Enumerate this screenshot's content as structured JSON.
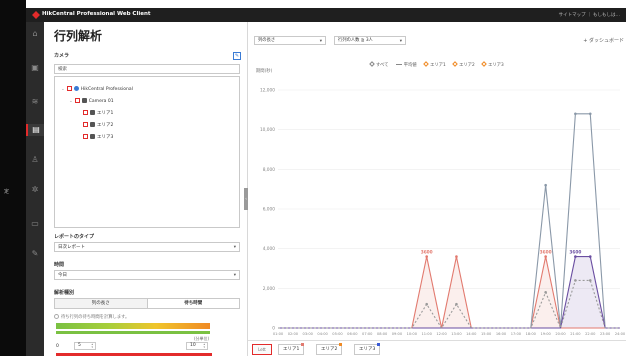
{
  "outer_label": "定",
  "app": {
    "title": "HikCentral Professional Web Client",
    "top_links": "サイトマップ ｜ もしもしは…"
  },
  "rail_icons": [
    {
      "name": "home-icon",
      "glyph": "⌂"
    },
    {
      "name": "image-icon",
      "glyph": "▣"
    },
    {
      "name": "map-icon",
      "glyph": "≋"
    },
    {
      "name": "report-icon",
      "glyph": "▤",
      "active": true
    },
    {
      "name": "people-icon",
      "glyph": "♙"
    },
    {
      "name": "settings-icon",
      "glyph": "✲"
    },
    {
      "name": "layers-icon",
      "glyph": "▭"
    },
    {
      "name": "pen-icon",
      "glyph": "✎"
    }
  ],
  "sidebar": {
    "title": "行列解析",
    "camera_label": "カメラ",
    "search_placeholder": "検索",
    "tree": [
      {
        "label": "HikCentral Professional",
        "icon": "site-icon"
      },
      {
        "label": "Camera 01",
        "icon": "camera-icon"
      },
      {
        "label": "エリア1",
        "icon": "area-icon"
      },
      {
        "label": "エリア2",
        "icon": "area-icon"
      },
      {
        "label": "エリア3",
        "icon": "area-icon"
      }
    ],
    "report_type_label": "レポートのタイプ",
    "report_type_value": "日次レポート",
    "time_label": "時間",
    "time_value": "今日",
    "analysis_label": "解析種別",
    "tab_queue_length": "列の長さ",
    "tab_wait_time": "待ち時間",
    "hint": "待ち行列の待ち時間を計算します。",
    "unit": "(分単位)",
    "range_min": "0",
    "range_max_input": "10",
    "low_input": "5"
  },
  "main": {
    "filter_1": "列の長さ",
    "filter_2": "行列の人数 ≧ 3人",
    "dashboard_button": "+ ダッシュボード",
    "legend": {
      "all": "すべて",
      "average": "平均値",
      "area1": "エリア1",
      "area2": "エリア2",
      "area3": "エリア3"
    },
    "bottom_tabs": [
      "エリア1",
      "エリア2",
      "エリア3"
    ],
    "bottom_left_button": "Lett"
  },
  "chart_data": {
    "type": "line",
    "ylabel": "期間(秒)",
    "ylim": [
      0,
      12000
    ],
    "yticks": [
      "0",
      "2,000",
      "4,000",
      "6,000",
      "8,000",
      "10,000",
      "12,000"
    ],
    "x": [
      "01:00",
      "02:00",
      "03:00",
      "04:00",
      "05:00",
      "06:00",
      "07:00",
      "08:00",
      "09:00",
      "10:00",
      "11:00",
      "12:00",
      "13:00",
      "14:00",
      "15:00",
      "16:00",
      "17:00",
      "18:00",
      "19:00",
      "20:00",
      "21:00",
      "22:00",
      "23:00",
      "24:00"
    ],
    "series": [
      {
        "name": "エリア1",
        "color": "#e27a6f",
        "style": "solid",
        "values": [
          0,
          0,
          0,
          0,
          0,
          0,
          0,
          0,
          0,
          0,
          3600,
          0,
          3600,
          0,
          0,
          0,
          0,
          0,
          3600,
          0,
          0,
          0,
          0,
          0
        ]
      },
      {
        "name": "エリア2",
        "color": "#8a98a8",
        "style": "solid",
        "values": [
          0,
          0,
          0,
          0,
          0,
          0,
          0,
          0,
          0,
          0,
          0,
          0,
          0,
          0,
          0,
          0,
          0,
          0,
          7200,
          0,
          10800,
          10800,
          0,
          0
        ]
      },
      {
        "name": "エリア3",
        "color": "#6a4ea1",
        "style": "solid",
        "values": [
          0,
          0,
          0,
          0,
          0,
          0,
          0,
          0,
          0,
          0,
          0,
          0,
          0,
          0,
          0,
          0,
          0,
          0,
          0,
          0,
          3600,
          3600,
          0,
          0
        ]
      },
      {
        "name": "平均値",
        "color": "#9a9a9a",
        "style": "dashed",
        "values": [
          0,
          0,
          0,
          0,
          0,
          0,
          0,
          0,
          0,
          0,
          1200,
          0,
          1200,
          0,
          0,
          0,
          0,
          0,
          1800,
          0,
          2400,
          2400,
          0,
          0
        ]
      }
    ],
    "point_labels": [
      {
        "series": 0,
        "index": 10,
        "text": "3600"
      },
      {
        "series": 0,
        "index": 18,
        "text": "3600"
      },
      {
        "series": 2,
        "index": 20,
        "text": "3600"
      }
    ]
  }
}
